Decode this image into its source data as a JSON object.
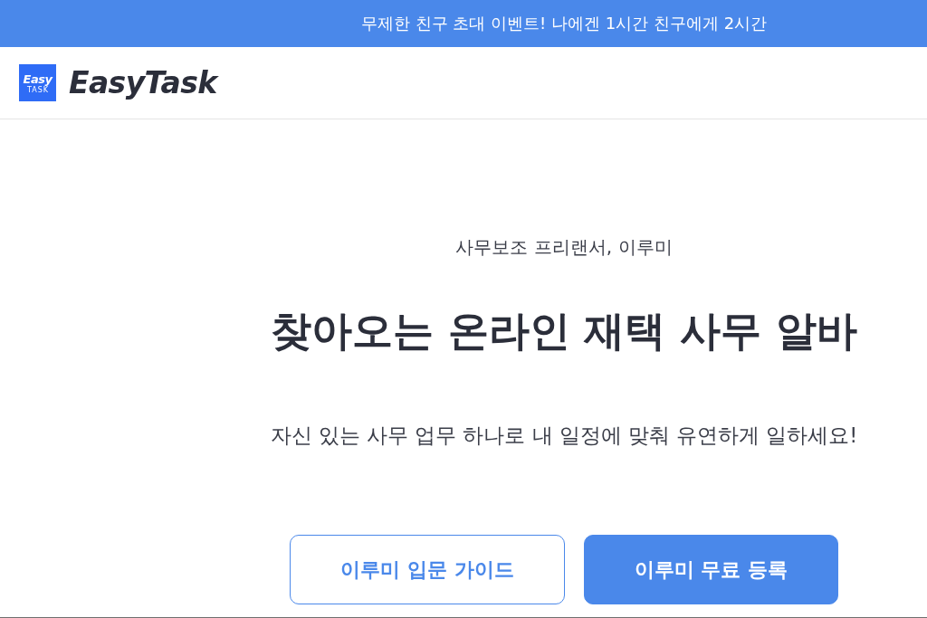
{
  "banner": {
    "text": "무제한 친구 초대 이벤트! 나에겐 1시간 친구에게 2시간"
  },
  "header": {
    "logo": {
      "badge_text": "Easy",
      "badge_subtext": "TASK",
      "wordmark": "EasyTask"
    }
  },
  "hero": {
    "eyebrow": "사무보조 프리랜서, 이루미",
    "title": "찾아오는 온라인 재택 사무 알바",
    "description": "자신 있는 사무 업무 하나로 내 일정에 맞춰 유연하게 일하세요!",
    "buttons": [
      {
        "label": "이루미 입문 가이드",
        "kind": "outline"
      },
      {
        "label": "이루미 무료 등록",
        "kind": "filled"
      }
    ]
  }
}
